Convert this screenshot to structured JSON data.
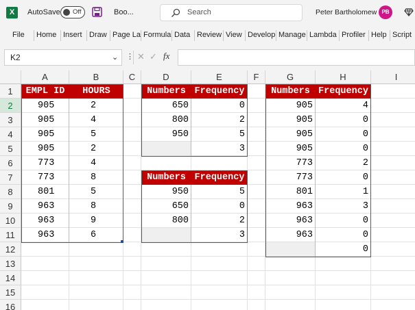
{
  "titlebar": {
    "app_icon": "X",
    "autosave_label": "AutoSave",
    "autosave_state": "Off",
    "doc_name": "Boo...",
    "search_placeholder": "Search",
    "user_name": "Peter Bartholomew",
    "avatar_initials": "PB"
  },
  "ribbon": {
    "tabs": [
      "File",
      "Home",
      "Insert",
      "Draw",
      "Page La",
      "Formula",
      "Data",
      "Review",
      "View",
      "Develop",
      "Manage",
      "Lambda",
      "Profiler",
      "Help",
      "Script"
    ]
  },
  "formula_bar": {
    "name_box": "K2",
    "dots": "⋮",
    "cancel_glyph": "✕",
    "enter_glyph": "✓",
    "fx_glyph": "fx",
    "formula": ""
  },
  "grid": {
    "columns": [
      "A",
      "B",
      "C",
      "D",
      "E",
      "F",
      "G",
      "H",
      "I"
    ],
    "rows": [
      "1",
      "2",
      "3",
      "4",
      "5",
      "6",
      "7",
      "8",
      "9",
      "10",
      "11",
      "12",
      "13",
      "14",
      "15",
      "16"
    ],
    "selected_cell": "K2"
  },
  "table1": {
    "headers": [
      "EMPL ID",
      "HOURS"
    ],
    "rows": [
      [
        "905",
        "2"
      ],
      [
        "905",
        "4"
      ],
      [
        "905",
        "5"
      ],
      [
        "905",
        "2"
      ],
      [
        "773",
        "4"
      ],
      [
        "773",
        "8"
      ],
      [
        "801",
        "5"
      ],
      [
        "963",
        "8"
      ],
      [
        "963",
        "9"
      ],
      [
        "963",
        "6"
      ]
    ]
  },
  "table2": {
    "headers": [
      "Numbers",
      "Frequency"
    ],
    "rows": [
      [
        "650",
        "0"
      ],
      [
        "800",
        "2"
      ],
      [
        "950",
        "5"
      ],
      [
        "",
        "3"
      ]
    ]
  },
  "table3": {
    "headers": [
      "Numbers",
      "Frequency"
    ],
    "rows": [
      [
        "950",
        "5"
      ],
      [
        "650",
        "0"
      ],
      [
        "800",
        "2"
      ],
      [
        "",
        "3"
      ]
    ]
  },
  "table4": {
    "headers": [
      "Numbers",
      "Frequency"
    ],
    "rows": [
      [
        "905",
        "4"
      ],
      [
        "905",
        "0"
      ],
      [
        "905",
        "0"
      ],
      [
        "905",
        "0"
      ],
      [
        "773",
        "2"
      ],
      [
        "773",
        "0"
      ],
      [
        "801",
        "1"
      ],
      [
        "963",
        "3"
      ],
      [
        "963",
        "0"
      ],
      [
        "963",
        "0"
      ],
      [
        "",
        "0"
      ]
    ]
  },
  "colors": {
    "header_fill": "#c00000",
    "accent": "#107c41",
    "avatar": "#d0158a"
  }
}
